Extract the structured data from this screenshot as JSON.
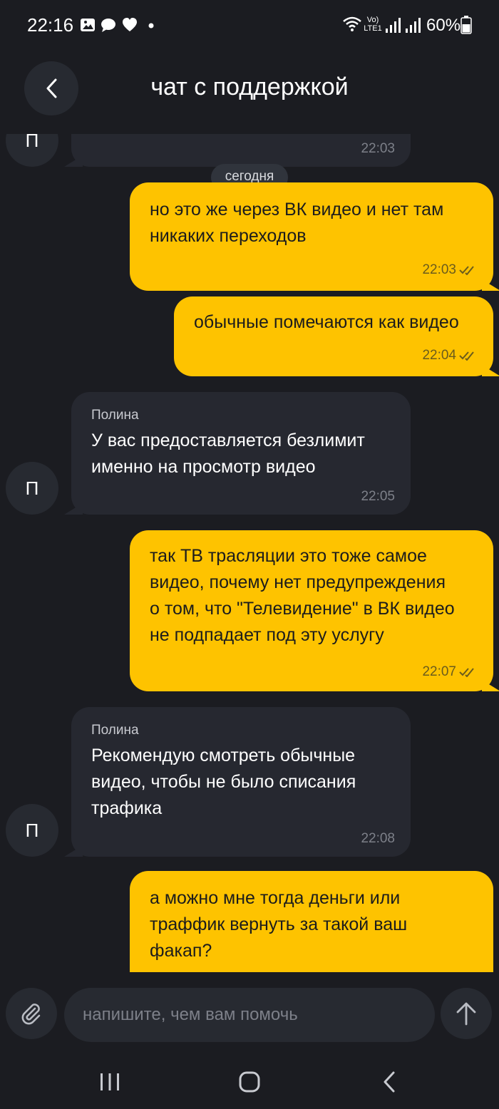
{
  "status_bar": {
    "time": "22:16",
    "battery": "60%",
    "network_label_top": "Vo)",
    "network_label_bottom": "LTE1"
  },
  "header": {
    "title": "чат с поддержкой"
  },
  "chat": {
    "date_separator": "сегодня",
    "avatar_letter": "П",
    "messages": [
      {
        "direction": "in",
        "sender": "",
        "text": "",
        "time": "22:03"
      },
      {
        "direction": "out",
        "text": "но это же через ВК видео и нет там\nникаких переходов",
        "time": "22:03",
        "read": true
      },
      {
        "direction": "out",
        "text": "обычные помечаются как видео",
        "time": "22:04",
        "read": true
      },
      {
        "direction": "in",
        "sender": "Полина",
        "text": "У вас предоставляется безлимит\nименно на просмотр видео",
        "time": "22:05"
      },
      {
        "direction": "out",
        "text": "так ТВ трасляции это тоже самое\nвидео, почему нет предупреждения\nо том, что \"Телевидение\" в ВК видео\nне подпадает под эту услугу",
        "time": "22:07",
        "read": true
      },
      {
        "direction": "in",
        "sender": "Полина",
        "text": "Рекомендую смотреть обычные\nвидео, чтобы не было списания\nтрафика",
        "time": "22:08"
      },
      {
        "direction": "out",
        "text": "а можно мне тогда деньги или\nтраффик вернуть за такой ваш\nфакап?",
        "time": "",
        "read": false
      }
    ]
  },
  "input": {
    "placeholder": "напишите, чем вам помочь"
  },
  "colors": {
    "background": "#1b1c21",
    "incoming_bubble": "#262830",
    "outgoing_bubble": "#fec300",
    "control_bg": "#272a31"
  }
}
